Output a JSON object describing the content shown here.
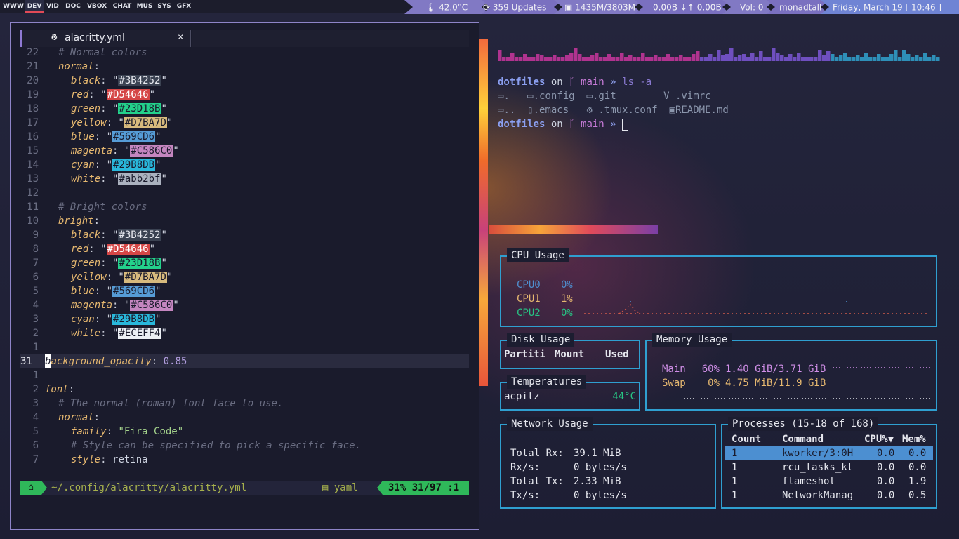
{
  "topbar": {
    "workspaces": [
      "WWW",
      "DEV",
      "VID",
      "DOC",
      "VBOX",
      "CHAT",
      "MUS",
      "SYS",
      "GFX"
    ],
    "active": "DEV",
    "temp": "42.0°C",
    "updates_count": "359",
    "updates_label": "Updates",
    "mem": "1435M/3803M",
    "net_down": "0.00B",
    "net_up": "0.00B",
    "vol": "Vol: 0",
    "user": "monadtall",
    "date": "Friday, March 19",
    "time": "[ 10:46 ]",
    "icons": {
      "temp": "thermometer-icon",
      "updates": "refresh-icon",
      "mem": "memory-icon",
      "net": "network-icon"
    }
  },
  "editor": {
    "tab_name": "alacritty.yml",
    "tab_close": "×",
    "line_numbers": [
      "22",
      "21",
      "20",
      "19",
      "18",
      "17",
      "16",
      "15",
      "14",
      "13",
      "12",
      "11",
      "10",
      "9",
      "8",
      "7",
      "6",
      "5",
      "4",
      "3",
      "2",
      "1",
      "31",
      "1",
      "2",
      "3",
      "4",
      "5",
      "6",
      "7"
    ],
    "normal_comment": "# Normal colors",
    "normal_key": "normal",
    "bright_comment": "# Bright colors",
    "bright_key": "bright",
    "colors_normal": [
      {
        "name": "black",
        "value": "#3B4252",
        "swatch": "#3B4252",
        "fg": "#e6e7ee"
      },
      {
        "name": "red",
        "value": "#D54646",
        "swatch": "#D54646",
        "fg": "#ffffff"
      },
      {
        "name": "green",
        "value": "#23D18B",
        "swatch": "#23D18B",
        "fg": "#1a1b2c"
      },
      {
        "name": "yellow",
        "value": "#D7BA7D",
        "swatch": "#D7BA7D",
        "fg": "#1a1b2c"
      },
      {
        "name": "blue",
        "value": "#569CD6",
        "swatch": "#569CD6",
        "fg": "#1a1b2c"
      },
      {
        "name": "magenta",
        "value": "#C586C0",
        "swatch": "#C586C0",
        "fg": "#1a1b2c"
      },
      {
        "name": "cyan",
        "value": "#29B8DB",
        "swatch": "#29B8DB",
        "fg": "#1a1b2c"
      },
      {
        "name": "white",
        "value": "#abb2bf",
        "swatch": "#abb2bf",
        "fg": "#1a1b2c"
      }
    ],
    "colors_bright": [
      {
        "name": "black",
        "value": "#3B4252",
        "swatch": "#3B4252",
        "fg": "#e6e7ee"
      },
      {
        "name": "red",
        "value": "#D54646",
        "swatch": "#D54646",
        "fg": "#ffffff"
      },
      {
        "name": "green",
        "value": "#23D18B",
        "swatch": "#23D18B",
        "fg": "#1a1b2c"
      },
      {
        "name": "yellow",
        "value": "#D7BA7D",
        "swatch": "#D7BA7D",
        "fg": "#1a1b2c"
      },
      {
        "name": "blue",
        "value": "#569CD6",
        "swatch": "#569CD6",
        "fg": "#1a1b2c"
      },
      {
        "name": "magenta",
        "value": "#C586C0",
        "swatch": "#C586C0",
        "fg": "#1a1b2c"
      },
      {
        "name": "cyan",
        "value": "#29B8DB",
        "swatch": "#29B8DB",
        "fg": "#1a1b2c"
      },
      {
        "name": "white",
        "value": "#ECEFF4",
        "swatch": "#ECEFF4",
        "fg": "#1a1b2c"
      }
    ],
    "opacity_key_first": "b",
    "opacity_key_rest": "ackground_opacity",
    "opacity_value": "0.85",
    "font_key": "font",
    "font_comment": "# The normal (roman) font face to use.",
    "font_normal_key": "normal",
    "family_key": "family",
    "family_value": "\"Fira Code\"",
    "style_comment": "# Style can be specified to pick a specific face.",
    "style_key": "style",
    "style_value": "retina",
    "status": {
      "path": "~/.config/alacritty/alacritty.yml",
      "filetype": "yaml",
      "percent": "31%",
      "pos": "31/97",
      "col": ":1"
    }
  },
  "terminal": {
    "prompt_dir": "dotfiles",
    "prompt_on": "on",
    "prompt_branch": "main",
    "prompt_chev": "»",
    "cmd": "ls -a",
    "files_row1": [
      ".",
      ".config",
      ".git",
      ".vimrc"
    ],
    "files_row2": [
      "..",
      ".emacs",
      ".tmux.conf",
      "README.md"
    ],
    "visualizer_levels": [
      0.8,
      0.3,
      0.3,
      0.6,
      0.3,
      0.3,
      0.5,
      0.3,
      0.3,
      0.5,
      0.4,
      0.3,
      0.3,
      0.4,
      0.3,
      0.3,
      0.4,
      0.6,
      0.9,
      0.5,
      0.3,
      0.3,
      0.4,
      0.6,
      0.3,
      0.3,
      0.5,
      0.3,
      0.3,
      0.6,
      0.3,
      0.4,
      0.3,
      0.3,
      0.6,
      0.3,
      0.3,
      0.4,
      0.3,
      0.3,
      0.5,
      0.3,
      0.3,
      0.4,
      0.3,
      0.3,
      0.5,
      0.7,
      0.3,
      0.3,
      0.5,
      0.3,
      0.8,
      0.4,
      0.5,
      0.9,
      0.3,
      0.4,
      0.5,
      0.3,
      0.6,
      0.3,
      0.7,
      0.3,
      0.3,
      0.9,
      0.6,
      0.4,
      0.3,
      0.5,
      0.3,
      0.6,
      0.3,
      0.3,
      0.3,
      0.3,
      0.8,
      0.4,
      0.7,
      0.5,
      0.3,
      0.4,
      0.6,
      0.3,
      0.3,
      0.4,
      0.3,
      0.6,
      0.3,
      0.3,
      0.5,
      0.3,
      0.3,
      0.5,
      0.8,
      0.3,
      0.8,
      0.5,
      0.3,
      0.4,
      0.3,
      0.6,
      0.3,
      0.4,
      0.3
    ]
  },
  "monitor": {
    "cpu": {
      "title": "CPU Usage",
      "rows": [
        {
          "label": "CPU0",
          "value": "0%",
          "color": "#4f8fd0"
        },
        {
          "label": "CPU1",
          "value": "1%",
          "color": "#e6b870"
        },
        {
          "label": "CPU2",
          "value": "0%",
          "color": "#27c484"
        }
      ]
    },
    "disk": {
      "title": "Disk Usage",
      "headers": [
        "Partiti",
        "Mount",
        "Used"
      ]
    },
    "temps": {
      "title": "Temperatures",
      "sensor": "acpitz",
      "value": "44°C"
    },
    "memory": {
      "title": "Memory Usage",
      "rows": [
        {
          "label": "Main",
          "pct": "60%",
          "amount": "1.40 GiB/3.71 GiB"
        },
        {
          "label": "Swap",
          "pct": "0%",
          "amount": "4.75 MiB/11.9 GiB"
        }
      ]
    },
    "network": {
      "title": "Network Usage",
      "rows": [
        {
          "label": "Total Rx:",
          "value": "39.1 MiB"
        },
        {
          "label": "Rx/s:",
          "value": "0 bytes/s"
        },
        {
          "label": "Total Tx:",
          "value": "2.33 MiB"
        },
        {
          "label": "Tx/s:",
          "value": "0 bytes/s"
        }
      ]
    },
    "processes": {
      "title": "Processes (15-18 of 168)",
      "headers": [
        "Count",
        "Command",
        "CPU%▼",
        "Mem%"
      ],
      "rows": [
        {
          "count": "1",
          "cmd": "kworker/3:0H",
          "cpu": "0.0",
          "mem": "0.0"
        },
        {
          "count": "1",
          "cmd": "rcu_tasks_kt",
          "cpu": "0.0",
          "mem": "0.0"
        },
        {
          "count": "1",
          "cmd": "flameshot",
          "cpu": "0.0",
          "mem": "1.9"
        },
        {
          "count": "1",
          "cmd": "NetworkManag",
          "cpu": "0.0",
          "mem": "0.5"
        }
      ]
    }
  }
}
